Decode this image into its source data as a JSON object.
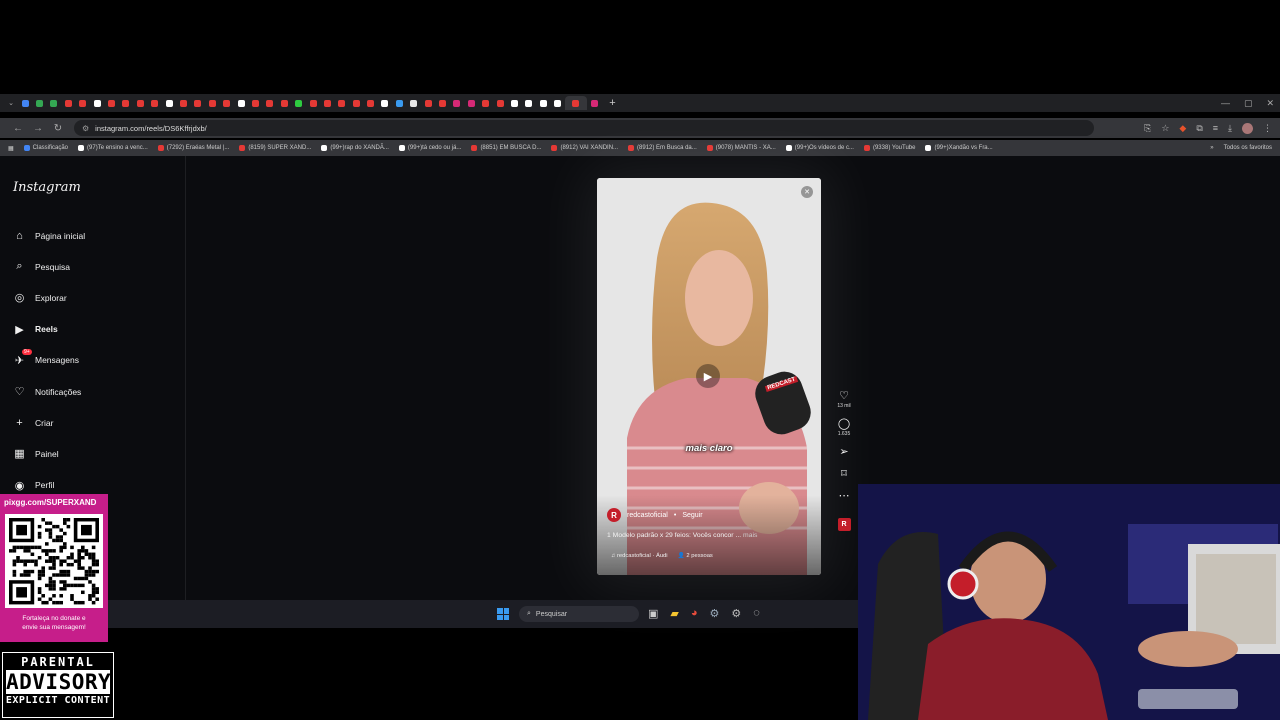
{
  "browser": {
    "url": "instagram.com/reels/DS6Kffrjdxb/",
    "tab_favicon_colors": [
      "#4285f4",
      "#34a853",
      "#34a853",
      "#e53935",
      "#e53935",
      "#ffffff",
      "#e53935",
      "#e53935",
      "#e53935",
      "#e53935",
      "#ffffff",
      "#e53935",
      "#e53935",
      "#e53935",
      "#e53935",
      "#ffffff",
      "#e53935",
      "#e53935",
      "#e53935",
      "#2ecc40",
      "#e53935",
      "#e53935",
      "#e53935",
      "#e53935",
      "#e53935",
      "#ffffff",
      "#3a9bf0",
      "#e8e8e8",
      "#e53935",
      "#e53935",
      "#d62976",
      "#d62976",
      "#e53935",
      "#e53935",
      "#ffffff",
      "#ffffff",
      "#ffffff",
      "#ffffff",
      "#e53935",
      "#d62976"
    ],
    "bookmarks": [
      {
        "label": "Classificação",
        "color": "#4285f4"
      },
      {
        "label": "(97)Te ensino a venc...",
        "color": "#ffffff"
      },
      {
        "label": "(7292) Eraéas Metal |...",
        "color": "#e53935"
      },
      {
        "label": "(8159) SUPER XAND...",
        "color": "#e53935"
      },
      {
        "label": "(99+)rap do XANDÃ...",
        "color": "#ffffff"
      },
      {
        "label": "(99+)tá cedo ou já...",
        "color": "#ffffff"
      },
      {
        "label": "(8851) EM BUSCA D...",
        "color": "#e53935"
      },
      {
        "label": "(8912) VAI XANDIN...",
        "color": "#e53935"
      },
      {
        "label": "(8912) Em Busca da...",
        "color": "#e53935"
      },
      {
        "label": "(9078) MANTIS - XA...",
        "color": "#e53935"
      },
      {
        "label": "(99+)Os vídeos de c...",
        "color": "#ffffff"
      },
      {
        "label": "(9338) YouTube",
        "color": "#e53935"
      },
      {
        "label": "(99+)Xandão vs Fra...",
        "color": "#ffffff"
      }
    ],
    "bookmarks_all": "Todos os favoritos"
  },
  "instagram": {
    "logo": "Instagram",
    "nav": [
      {
        "label": "Página inicial",
        "icon": "home-icon",
        "glyph": "⌂"
      },
      {
        "label": "Pesquisa",
        "icon": "search-icon",
        "glyph": "⌕"
      },
      {
        "label": "Explorar",
        "icon": "compass-icon",
        "glyph": "◎"
      },
      {
        "label": "Reels",
        "icon": "reels-icon",
        "glyph": "▶"
      },
      {
        "label": "Mensagens",
        "icon": "messenger-icon",
        "glyph": "✈"
      },
      {
        "label": "Notificações",
        "icon": "heart-icon",
        "glyph": "♡"
      },
      {
        "label": "Criar",
        "icon": "plus-icon",
        "glyph": "+"
      },
      {
        "label": "Painel",
        "icon": "dashboard-icon",
        "glyph": "▦"
      },
      {
        "label": "Perfil",
        "icon": "profile-icon",
        "glyph": "◉"
      }
    ],
    "messages_badge": "9+",
    "reel": {
      "caption_overlay": "mais claro",
      "author": "redcastoficial",
      "author_initial": "R",
      "separator": "•",
      "follow": "Seguir",
      "description": "1 Modelo padrão x 29 feios: Vocês concor ...",
      "more": "mais",
      "audio": "redcastoficial · Áudi",
      "people": "2 pessoas",
      "mic_label": "REDCAST",
      "likes": "13 mil",
      "comments": "1.635"
    }
  },
  "taskbar": {
    "search_placeholder": "Pesquisar"
  },
  "overlay": {
    "qr_title": "pixgg.com/SUPERXAND",
    "qr_footer_1": "Fortaleça no donate e",
    "qr_footer_2": "envie sua mensagem!",
    "advisory_1": "PARENTAL",
    "advisory_2": "ADVISORY",
    "advisory_3": "EXPLICIT CONTENT"
  }
}
